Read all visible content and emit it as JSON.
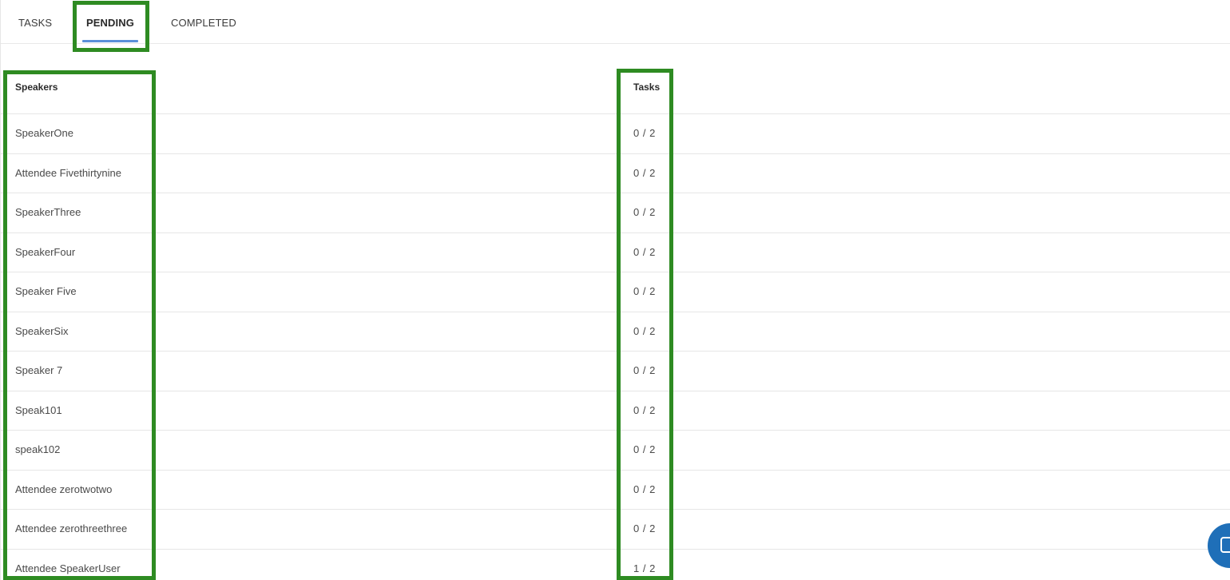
{
  "tabs": [
    {
      "label": "TASKS"
    },
    {
      "label": "PENDING"
    },
    {
      "label": "COMPLETED"
    }
  ],
  "active_tab": "PENDING",
  "table": {
    "headers": {
      "speakers": "Speakers",
      "tasks": "Tasks"
    },
    "rows": [
      {
        "name": "SpeakerOne",
        "tasks": "0 / 2"
      },
      {
        "name": "Attendee Fivethirtynine",
        "tasks": "0 / 2"
      },
      {
        "name": "SpeakerThree",
        "tasks": "0 / 2"
      },
      {
        "name": "SpeakerFour",
        "tasks": "0 / 2"
      },
      {
        "name": "Speaker Five",
        "tasks": "0 / 2"
      },
      {
        "name": "SpeakerSix",
        "tasks": "0 / 2"
      },
      {
        "name": "Speaker 7",
        "tasks": "0 / 2"
      },
      {
        "name": "Speak101",
        "tasks": "0 / 2"
      },
      {
        "name": "speak102",
        "tasks": "0 / 2"
      },
      {
        "name": "Attendee zerotwotwo",
        "tasks": "0 / 2"
      },
      {
        "name": "Attendee zerothreethree",
        "tasks": "0 / 2"
      },
      {
        "name": "Attendee SpeakerUser",
        "tasks": "1 / 2"
      }
    ]
  },
  "colors": {
    "tab_underline": "#5b8fd9",
    "highlight_box": "#2e8b22",
    "chat_button": "#1f6fb8"
  },
  "icons": {
    "chat": "chat-icon"
  }
}
